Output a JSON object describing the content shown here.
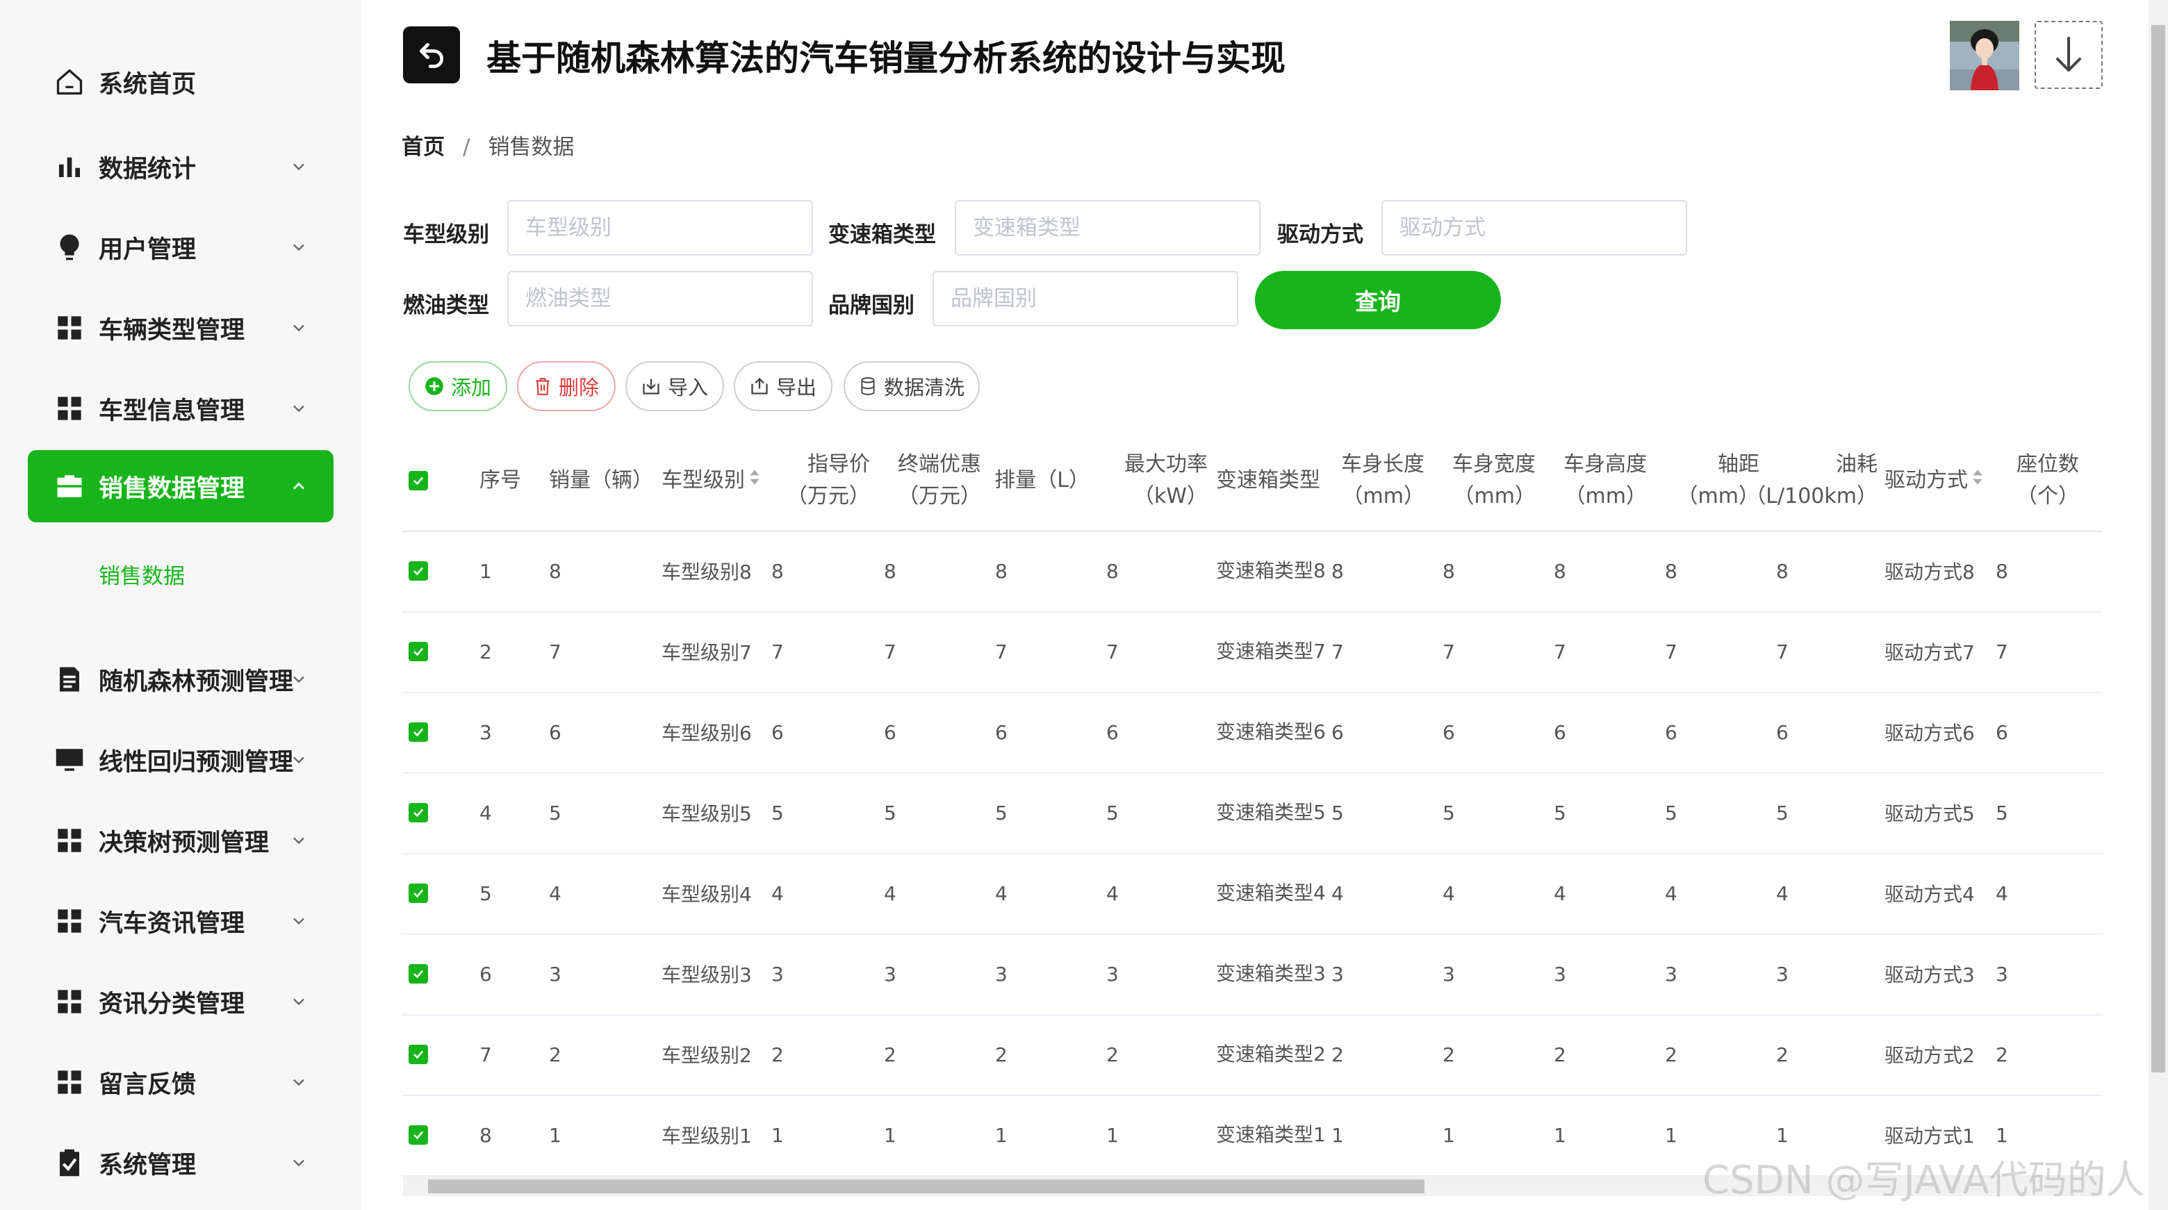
{
  "sidebar": {
    "items": [
      {
        "label": "系统首页",
        "icon": "home-icon",
        "has_children": false,
        "active": false
      },
      {
        "label": "数据统计",
        "icon": "bar-chart-icon",
        "has_children": true,
        "active": false
      },
      {
        "label": "用户管理",
        "icon": "lightbulb-icon",
        "has_children": true,
        "active": false
      },
      {
        "label": "车辆类型管理",
        "icon": "grid-icon",
        "has_children": true,
        "active": false
      },
      {
        "label": "车型信息管理",
        "icon": "grid-icon",
        "has_children": true,
        "active": false
      },
      {
        "label": "销售数据管理",
        "icon": "briefcase-icon",
        "has_children": true,
        "active": true
      },
      {
        "label": "随机森林预测管理",
        "icon": "document-icon",
        "has_children": true,
        "active": false
      },
      {
        "label": "线性回归预测管理",
        "icon": "monitor-icon",
        "has_children": true,
        "active": false
      },
      {
        "label": "决策树预测管理",
        "icon": "grid-icon",
        "has_children": true,
        "active": false
      },
      {
        "label": "汽车资讯管理",
        "icon": "grid-icon",
        "has_children": true,
        "active": false
      },
      {
        "label": "资讯分类管理",
        "icon": "grid-icon",
        "has_children": true,
        "active": false
      },
      {
        "label": "留言反馈",
        "icon": "grid-icon",
        "has_children": true,
        "active": false
      },
      {
        "label": "系统管理",
        "icon": "clipboard-check-icon",
        "has_children": true,
        "active": false
      }
    ],
    "sub_item": "销售数据"
  },
  "header": {
    "title": "基于随机森林算法的汽车销量分析系统的设计与实现"
  },
  "breadcrumb": {
    "home": "首页",
    "separator": "/",
    "current": "销售数据"
  },
  "filters": {
    "model_level": {
      "label": "车型级别",
      "placeholder": "车型级别",
      "value": ""
    },
    "gearbox_type": {
      "label": "变速箱类型",
      "placeholder": "变速箱类型",
      "value": ""
    },
    "drive_mode": {
      "label": "驱动方式",
      "placeholder": "驱动方式",
      "value": ""
    },
    "fuel_type": {
      "label": "燃油类型",
      "placeholder": "燃油类型",
      "value": ""
    },
    "brand_country": {
      "label": "品牌国别",
      "placeholder": "品牌国别",
      "value": ""
    },
    "query_label": "查询"
  },
  "actions": {
    "add": "添加",
    "delete": "删除",
    "import": "导入",
    "export": "导出",
    "clean": "数据清洗"
  },
  "table": {
    "headers": {
      "index": "序号",
      "sales": "销量（辆）",
      "level": "车型级别",
      "guide_price": "指导价（万元）",
      "discount": "终端优惠（万元）",
      "displacement": "排量（L）",
      "max_power": "最大功率（kW）",
      "gearbox": "变速箱类型",
      "length": "车身长度（mm）",
      "width": "车身宽度（mm）",
      "height": "车身高度（mm）",
      "wheelbase": "轴距（mm）",
      "fuel": "油耗（L/100km）",
      "drive": "驱动方式",
      "seats": "座位数（个）"
    },
    "rows": [
      {
        "index": "1",
        "sales": "8",
        "level": "车型级别8",
        "guide_price": "8",
        "discount": "8",
        "displacement": "8",
        "max_power": "8",
        "gearbox": "变速箱类型8",
        "length": "8",
        "width": "8",
        "height": "8",
        "wheelbase": "8",
        "fuel": "8",
        "drive": "驱动方式8",
        "seats": "8"
      },
      {
        "index": "2",
        "sales": "7",
        "level": "车型级别7",
        "guide_price": "7",
        "discount": "7",
        "displacement": "7",
        "max_power": "7",
        "gearbox": "变速箱类型7",
        "length": "7",
        "width": "7",
        "height": "7",
        "wheelbase": "7",
        "fuel": "7",
        "drive": "驱动方式7",
        "seats": "7"
      },
      {
        "index": "3",
        "sales": "6",
        "level": "车型级别6",
        "guide_price": "6",
        "discount": "6",
        "displacement": "6",
        "max_power": "6",
        "gearbox": "变速箱类型6",
        "length": "6",
        "width": "6",
        "height": "6",
        "wheelbase": "6",
        "fuel": "6",
        "drive": "驱动方式6",
        "seats": "6"
      },
      {
        "index": "4",
        "sales": "5",
        "level": "车型级别5",
        "guide_price": "5",
        "discount": "5",
        "displacement": "5",
        "max_power": "5",
        "gearbox": "变速箱类型5",
        "length": "5",
        "width": "5",
        "height": "5",
        "wheelbase": "5",
        "fuel": "5",
        "drive": "驱动方式5",
        "seats": "5"
      },
      {
        "index": "5",
        "sales": "4",
        "level": "车型级别4",
        "guide_price": "4",
        "discount": "4",
        "displacement": "4",
        "max_power": "4",
        "gearbox": "变速箱类型4",
        "length": "4",
        "width": "4",
        "height": "4",
        "wheelbase": "4",
        "fuel": "4",
        "drive": "驱动方式4",
        "seats": "4"
      },
      {
        "index": "6",
        "sales": "3",
        "level": "车型级别3",
        "guide_price": "3",
        "discount": "3",
        "displacement": "3",
        "max_power": "3",
        "gearbox": "变速箱类型3",
        "length": "3",
        "width": "3",
        "height": "3",
        "wheelbase": "3",
        "fuel": "3",
        "drive": "驱动方式3",
        "seats": "3"
      },
      {
        "index": "7",
        "sales": "2",
        "level": "车型级别2",
        "guide_price": "2",
        "discount": "2",
        "displacement": "2",
        "max_power": "2",
        "gearbox": "变速箱类型2",
        "length": "2",
        "width": "2",
        "height": "2",
        "wheelbase": "2",
        "fuel": "2",
        "drive": "驱动方式2",
        "seats": "2"
      },
      {
        "index": "8",
        "sales": "1",
        "level": "车型级别1",
        "guide_price": "1",
        "discount": "1",
        "displacement": "1",
        "max_power": "1",
        "gearbox": "变速箱类型1",
        "length": "1",
        "width": "1",
        "height": "1",
        "wheelbase": "1",
        "fuel": "1",
        "drive": "驱动方式1",
        "seats": "1"
      }
    ]
  },
  "watermark": "CSDN @写JAVA代码的人",
  "colors": {
    "accent": "#17b51b",
    "danger": "#e23b3b",
    "sidebar_bg": "#f7f7f7"
  }
}
